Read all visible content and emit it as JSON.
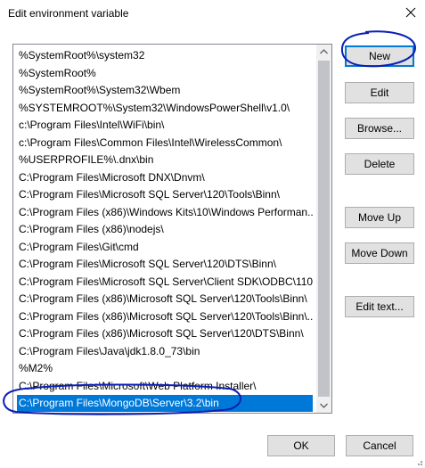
{
  "window": {
    "title": "Edit environment variable",
    "close_icon": "close-icon"
  },
  "paths": [
    "%SystemRoot%\\system32",
    "%SystemRoot%",
    "%SystemRoot%\\System32\\Wbem",
    "%SYSTEMROOT%\\System32\\WindowsPowerShell\\v1.0\\",
    "c:\\Program Files\\Intel\\WiFi\\bin\\",
    "c:\\Program Files\\Common Files\\Intel\\WirelessCommon\\",
    "%USERPROFILE%\\.dnx\\bin",
    "C:\\Program Files\\Microsoft DNX\\Dnvm\\",
    "C:\\Program Files\\Microsoft SQL Server\\120\\Tools\\Binn\\",
    "C:\\Program Files (x86)\\Windows Kits\\10\\Windows Performan...",
    "C:\\Program Files (x86)\\nodejs\\",
    "C:\\Program Files\\Git\\cmd",
    "C:\\Program Files\\Microsoft SQL Server\\120\\DTS\\Binn\\",
    "C:\\Program Files\\Microsoft SQL Server\\Client SDK\\ODBC\\110...",
    "C:\\Program Files (x86)\\Microsoft SQL Server\\120\\Tools\\Binn\\",
    "C:\\Program Files (x86)\\Microsoft SQL Server\\120\\Tools\\Binn\\...",
    "C:\\Program Files (x86)\\Microsoft SQL Server\\120\\DTS\\Binn\\",
    "C:\\Program Files\\Java\\jdk1.8.0_73\\bin",
    "%M2%",
    "C:\\Program Files\\Microsoft\\Web Platform Installer\\",
    "C:\\Program Files\\MongoDB\\Server\\3.2\\bin"
  ],
  "selected_index": 20,
  "buttons": {
    "new": "New",
    "edit": "Edit",
    "browse": "Browse...",
    "delete": "Delete",
    "move_up": "Move Up",
    "move_down": "Move Down",
    "edit_text": "Edit text...",
    "ok": "OK",
    "cancel": "Cancel"
  },
  "colors": {
    "selection": "#0078d7",
    "annotation_ink": "#0a1fb5"
  }
}
